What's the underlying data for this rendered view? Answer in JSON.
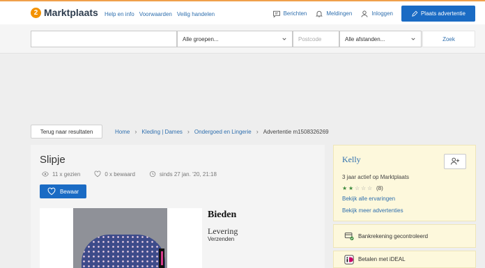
{
  "header": {
    "logo_text": "Marktplaats",
    "links": [
      "Help en info",
      "Voorwaarden",
      "Veilig handelen"
    ],
    "messages": "Berichten",
    "notifications": "Meldingen",
    "login": "Inloggen",
    "post_ad": "Plaats advertentie"
  },
  "search": {
    "query_value": "",
    "group_select": "Alle groepen...",
    "postcode_placeholder": "Postcode",
    "distance_select": "Alle afstanden...",
    "button": "Zoek"
  },
  "nav": {
    "back": "Terug naar resultaten",
    "breadcrumb": [
      "Home",
      "Kleding | Dames",
      "Ondergoed en Lingerie",
      "Advertentie m1508326269"
    ]
  },
  "listing": {
    "title": "Slipje",
    "views": "11 x gezien",
    "saves": "0 x bewaard",
    "since": "sinds 27 jan. '20, 21:18",
    "save_button": "Bewaar",
    "price_label": "Bieden",
    "delivery_label": "Levering",
    "delivery_value": "Verzenden"
  },
  "seller": {
    "name": "Kelly",
    "active": "3 jaar actief op Marktplaats",
    "rating_value": 2,
    "rating_max": 5,
    "rating_count": "(8)",
    "link_reviews": "Bekijk alle ervaringen",
    "link_more": "Bekijk meer advertenties",
    "bank_verified": "Bankrekening gecontroleerd",
    "ideal": "Betalen met iDEAL"
  },
  "colors": {
    "brand_orange": "#f39200",
    "primary_blue": "#1a6bc4",
    "link_blue": "#2f6fae",
    "seller_bg": "#fdf8dc",
    "ideal_pink": "#cc0066"
  }
}
